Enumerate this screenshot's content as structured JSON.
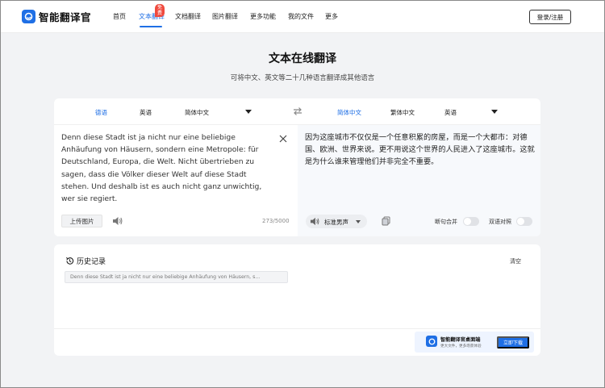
{
  "header": {
    "logo_text": "智能翻译官",
    "nav": [
      {
        "label": "首页",
        "active": false
      },
      {
        "label": "文本翻译",
        "active": true,
        "badge": "免费"
      },
      {
        "label": "文档翻译",
        "active": false
      },
      {
        "label": "图片翻译",
        "active": false
      },
      {
        "label": "更多功能",
        "active": false
      },
      {
        "label": "我的文件",
        "active": false
      },
      {
        "label": "更多",
        "active": false
      }
    ],
    "login_label": "登录/注册"
  },
  "page": {
    "title": "文本在线翻译",
    "subtitle": "可将中文、英文等二十几种语言翻译成其他语言"
  },
  "translator": {
    "source_langs": [
      "德语",
      "英语",
      "简体中文"
    ],
    "target_langs": [
      "简体中文",
      "繁体中文",
      "英语"
    ],
    "source_text": "Denn diese Stadt ist ja nicht nur eine beliebige Anhäufung von Häusern, sondern eine Metropole: für Deutschland, Europa, die Welt. Nicht übertrieben zu sagen, dass die Völker dieser Welt auf diese Stadt stehen. Und deshalb ist es auch nicht ganz unwichtig, wer sie regiert.",
    "target_text": "因为这座城市不仅仅是一个任意积累的房屋，而是一个大都市：对德国、欧洲、世界来说。更不用说这个世界的人民进入了这座城市。这就是为什么谁来管理他们并非完全不重要。",
    "upload_label": "上传图片",
    "char_count": "273/5000",
    "voice_label": "标准男声",
    "toggle_merge_label": "断句合并",
    "toggle_bilingual_label": "双语对照",
    "toggle_merge_on": false,
    "toggle_bilingual_on": false
  },
  "history": {
    "title": "历史记录",
    "clear_label": "清空",
    "items": [
      "Denn diese Stadt ist ja nicht nur eine beliebige Anhäufung von Häusern, s..."
    ]
  },
  "promo": {
    "title": "智能翻译官桌面端",
    "desc": "更大文件，更多场景体验",
    "button": "立即下载"
  },
  "colors": {
    "accent": "#1f6fe5",
    "badge": "#f04a3e",
    "background": "#f2f3f5"
  }
}
